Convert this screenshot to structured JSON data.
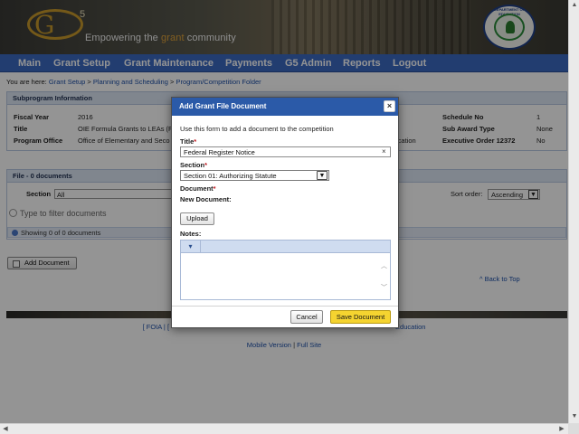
{
  "header": {
    "logo_letter": "G",
    "logo_superscript": "5",
    "tagline_before": "Empowering the ",
    "tagline_highlight": "grant",
    "tagline_after": " community",
    "seal_text": "DEPARTMENT OF EDUCATION"
  },
  "nav": {
    "items": [
      "Main",
      "Grant Setup",
      "Grant Maintenance",
      "Payments",
      "G5 Admin",
      "Reports",
      "Logout"
    ]
  },
  "breadcrumb": {
    "prefix": "You are here:",
    "links": [
      "Grant Setup",
      "Planning and Scheduling",
      "Program/Competition Folder"
    ],
    "separator": ">"
  },
  "subprogram": {
    "heading": "Subprogram Information",
    "fiscal_year_label": "Fiscal Year",
    "fiscal_year_value": "2016",
    "title_label": "Title",
    "title_value": "OIE Formula Grants to LEAs (FO",
    "program_office_label": "Program Office",
    "program_office_value": "Office of Elementary and Seco",
    "partial_value": "ication",
    "schedule_no_label": "Schedule No",
    "schedule_no_value": "1",
    "sub_award_type_label": "Sub Award Type",
    "sub_award_type_value": "None",
    "executive_order_label": "Executive Order 12372",
    "executive_order_value": "No"
  },
  "files": {
    "heading": "File - 0 documents",
    "section_label": "Section",
    "section_value": "All",
    "sort_label": "Sort order:",
    "sort_value": "Ascending",
    "filter_placeholder": "Type to filter documents",
    "showing_text": "Showing 0 of 0 documents",
    "add_document_label": "Add Document",
    "back_to_top": "^ Back to Top"
  },
  "footer": {
    "links_left": "[ FOIA | [",
    "links_right": "Education",
    "mobile_link": "Mobile Version",
    "full_site_link": "Full Site",
    "separator": "|"
  },
  "modal": {
    "title": "Add Grant File Document",
    "close_symbol": "×",
    "intro": "Use this form to add a document to the competition",
    "title_label": "Title",
    "title_value": "Federal Register Notice",
    "clear_symbol": "×",
    "section_label": "Section",
    "section_value": "Section 01: Authorizing Statute",
    "document_label": "Document",
    "new_document_label": "New Document:",
    "upload_label": "Upload",
    "notes_label": "Notes:",
    "required_marker": "*",
    "cancel_label": "Cancel",
    "save_label": "Save Document"
  },
  "colors": {
    "nav_bg": "#3c6ac2",
    "modal_header": "#2b5aa8",
    "save_button": "#f5d430",
    "required": "#c0181f"
  }
}
